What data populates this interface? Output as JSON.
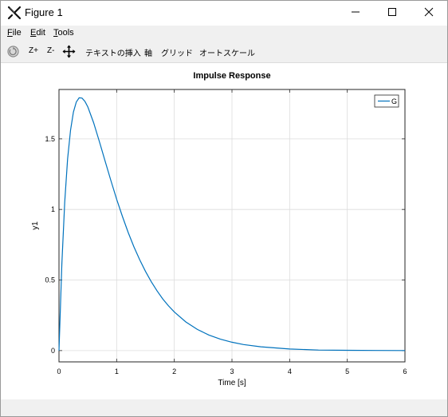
{
  "window": {
    "title": "Figure 1",
    "minimize_icon": "minimize-icon",
    "maximize_icon": "maximize-icon",
    "close_icon": "close-icon"
  },
  "menu": {
    "items": [
      {
        "label": "File",
        "mnemonic": "F",
        "rest": "ile"
      },
      {
        "label": "Edit",
        "mnemonic": "E",
        "rest": "dit"
      },
      {
        "label": "Tools",
        "mnemonic": "T",
        "rest": "ools"
      }
    ]
  },
  "toolbar": {
    "rotate_icon": "rotate-icon",
    "zoom_in": "Z+",
    "zoom_out": "Z-",
    "pan_icon": "pan-icon",
    "insert_text": "テキストの挿入",
    "axes": "軸",
    "grid": "グリッド",
    "autoscale": "オートスケール"
  },
  "chart_data": {
    "type": "line",
    "title": "Impulse Response",
    "xlabel": "Time [s]",
    "ylabel": "y1",
    "xlim": [
      0,
      6
    ],
    "ylim": [
      -0.08,
      1.85
    ],
    "xticks": [
      0,
      1,
      2,
      3,
      4,
      5,
      6
    ],
    "yticks": [
      0,
      0.5,
      1,
      1.5
    ],
    "xtick_labels": [
      "0",
      "1",
      "2",
      "3",
      "4",
      "5",
      "6"
    ],
    "ytick_labels": [
      "0",
      "0.5",
      "1",
      "1.5"
    ],
    "grid": true,
    "legend_position": "top-right",
    "series": [
      {
        "name": "G",
        "color": "#0072bd",
        "x": [
          0,
          0.05,
          0.1,
          0.15,
          0.2,
          0.25,
          0.3,
          0.35,
          0.4,
          0.45,
          0.5,
          0.6,
          0.7,
          0.8,
          0.9,
          1.0,
          1.1,
          1.2,
          1.3,
          1.4,
          1.5,
          1.6,
          1.7,
          1.8,
          1.9,
          2.0,
          2.2,
          2.4,
          2.6,
          2.8,
          3.0,
          3.2,
          3.5,
          4.0,
          4.5,
          5.0,
          5.5,
          6.0
        ],
        "y": [
          0,
          0.614,
          1.053,
          1.358,
          1.562,
          1.69,
          1.761,
          1.791,
          1.789,
          1.766,
          1.726,
          1.615,
          1.482,
          1.342,
          1.205,
          1.073,
          0.95,
          0.837,
          0.735,
          0.643,
          0.561,
          0.488,
          0.423,
          0.366,
          0.317,
          0.273,
          0.203,
          0.15,
          0.11,
          0.081,
          0.059,
          0.043,
          0.027,
          0.011,
          0.004,
          0.002,
          0.001,
          0.0002
        ]
      }
    ]
  }
}
